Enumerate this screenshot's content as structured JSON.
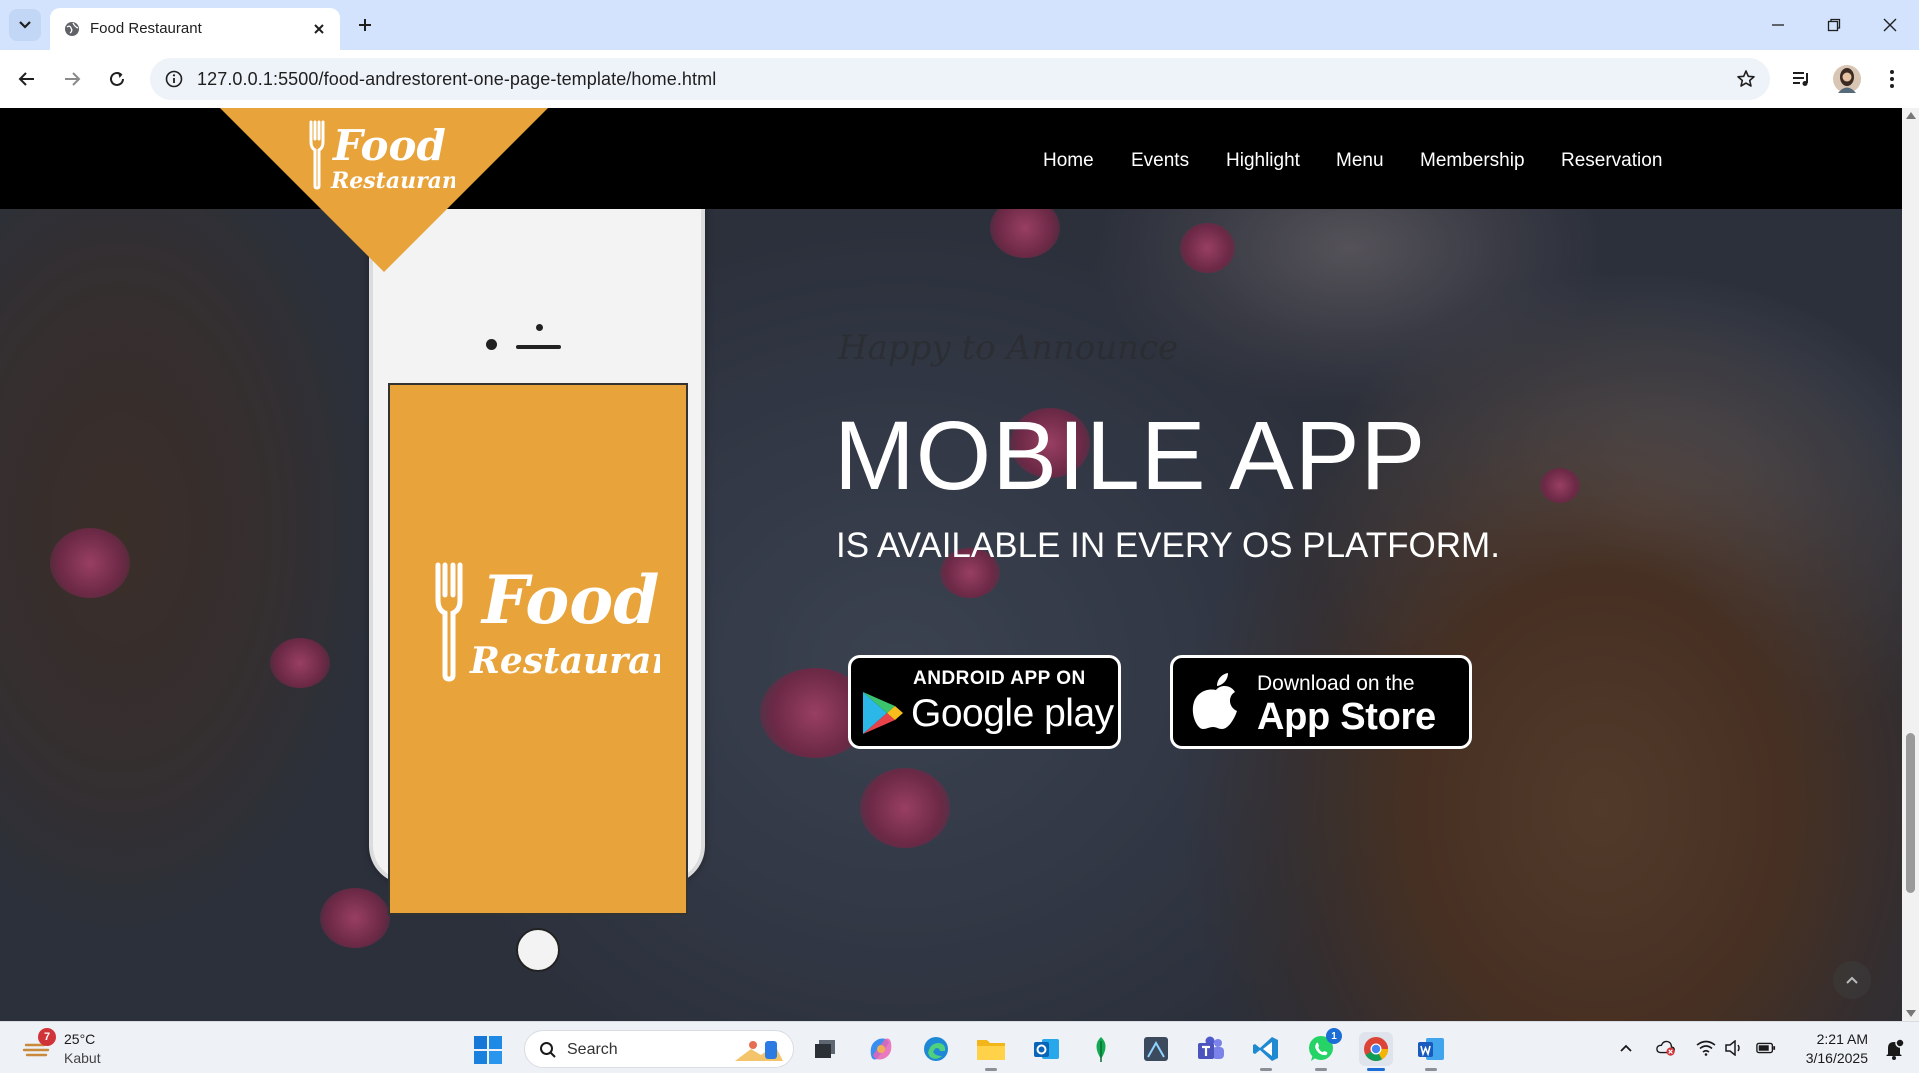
{
  "browser": {
    "tab_title": "Food Restaurant",
    "url": "127.0.0.1:5500/food-andrestorent-one-page-template/home.html"
  },
  "site": {
    "logo_text_top": "Food",
    "logo_text_bottom": "Restaurant",
    "nav": [
      "Home",
      "Events",
      "Highlight",
      "Menu",
      "Membership",
      "Reservation"
    ],
    "brand_color": "#e8a33a"
  },
  "hero": {
    "tagline": "Happy to Announce",
    "title": "MOBILE APP",
    "subtitle": "IS AVAILABLE IN EVERY OS PLATFORM.",
    "google_play": {
      "top": "ANDROID APP ON",
      "bottom": "Google play"
    },
    "app_store": {
      "top": "Download on the",
      "bottom": "App Store"
    }
  },
  "taskbar": {
    "weather": {
      "badge": "7",
      "temp": "25°C",
      "desc": "Kabut"
    },
    "search_label": "Search",
    "whatsapp_badge": "1",
    "time": "2:21 AM",
    "date": "3/16/2025"
  }
}
